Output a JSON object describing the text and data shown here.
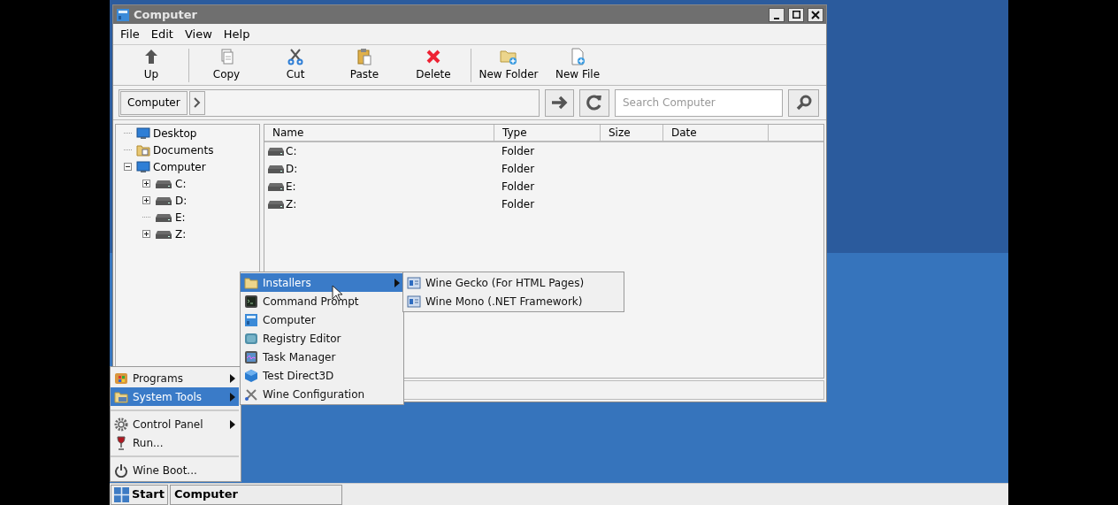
{
  "window": {
    "title": "Computer"
  },
  "menu": [
    "File",
    "Edit",
    "View",
    "Help"
  ],
  "toolbar": [
    {
      "label": "Up",
      "kind": "up"
    },
    {
      "label": "Copy",
      "kind": "copy"
    },
    {
      "label": "Cut",
      "kind": "cut"
    },
    {
      "label": "Paste",
      "kind": "paste"
    },
    {
      "label": "Delete",
      "kind": "delete"
    },
    {
      "label": "New Folder",
      "kind": "new-folder"
    },
    {
      "label": "New File",
      "kind": "new-file"
    }
  ],
  "address": {
    "crumb": "Computer",
    "search_placeholder": "Search Computer"
  },
  "tree": [
    {
      "label": "Desktop",
      "kind": "monitor"
    },
    {
      "label": "Documents",
      "kind": "documents"
    },
    {
      "label": "Computer",
      "kind": "monitor",
      "expanded": true,
      "children": [
        {
          "label": "C:",
          "kind": "drive",
          "expanded": false
        },
        {
          "label": "D:",
          "kind": "drive",
          "expanded": false
        },
        {
          "label": "E:",
          "kind": "drive"
        },
        {
          "label": "Z:",
          "kind": "drive",
          "expanded": false
        }
      ]
    }
  ],
  "table": {
    "columns": [
      "Name",
      "Type",
      "Size",
      "Date"
    ],
    "rows": [
      {
        "name": "C:",
        "type": "Folder"
      },
      {
        "name": "D:",
        "type": "Folder"
      },
      {
        "name": "E:",
        "type": "Folder"
      },
      {
        "name": "Z:",
        "type": "Folder"
      }
    ]
  },
  "start_menu": [
    {
      "items": [
        {
          "label": "Programs",
          "kind": "programs",
          "submenu": true,
          "selected": false
        },
        {
          "label": "System Tools",
          "kind": "tools-folder",
          "submenu": true,
          "selected": true
        }
      ]
    },
    {
      "items": [
        {
          "label": "Control Panel",
          "kind": "gear",
          "submenu": true,
          "selected": false
        },
        {
          "label": "Run...",
          "kind": "wine",
          "submenu": false,
          "selected": false
        }
      ]
    },
    {
      "items": [
        {
          "label": "Wine Boot...",
          "kind": "power",
          "submenu": false,
          "selected": false
        }
      ]
    }
  ],
  "system_tools_menu": [
    {
      "label": "Installers",
      "kind": "folder",
      "submenu": true,
      "selected": true
    },
    {
      "label": "Command Prompt",
      "kind": "terminal",
      "submenu": false,
      "selected": false
    },
    {
      "label": "Computer",
      "kind": "computer",
      "submenu": false,
      "selected": false
    },
    {
      "label": "Registry Editor",
      "kind": "cube",
      "submenu": false,
      "selected": false
    },
    {
      "label": "Task Manager",
      "kind": "taskmgr",
      "submenu": false,
      "selected": false
    },
    {
      "label": "Test Direct3D",
      "kind": "cube-blue",
      "submenu": false,
      "selected": false
    },
    {
      "label": "Wine Configuration",
      "kind": "tools",
      "submenu": false,
      "selected": false
    }
  ],
  "installers_menu": [
    {
      "label": "Wine Gecko (For HTML Pages)",
      "kind": "installer",
      "submenu": false,
      "selected": false
    },
    {
      "label": "Wine Mono (.NET Framework)",
      "kind": "installer",
      "submenu": false,
      "selected": false
    }
  ],
  "taskbar": {
    "start": "Start",
    "tasks": [
      "Computer"
    ]
  }
}
